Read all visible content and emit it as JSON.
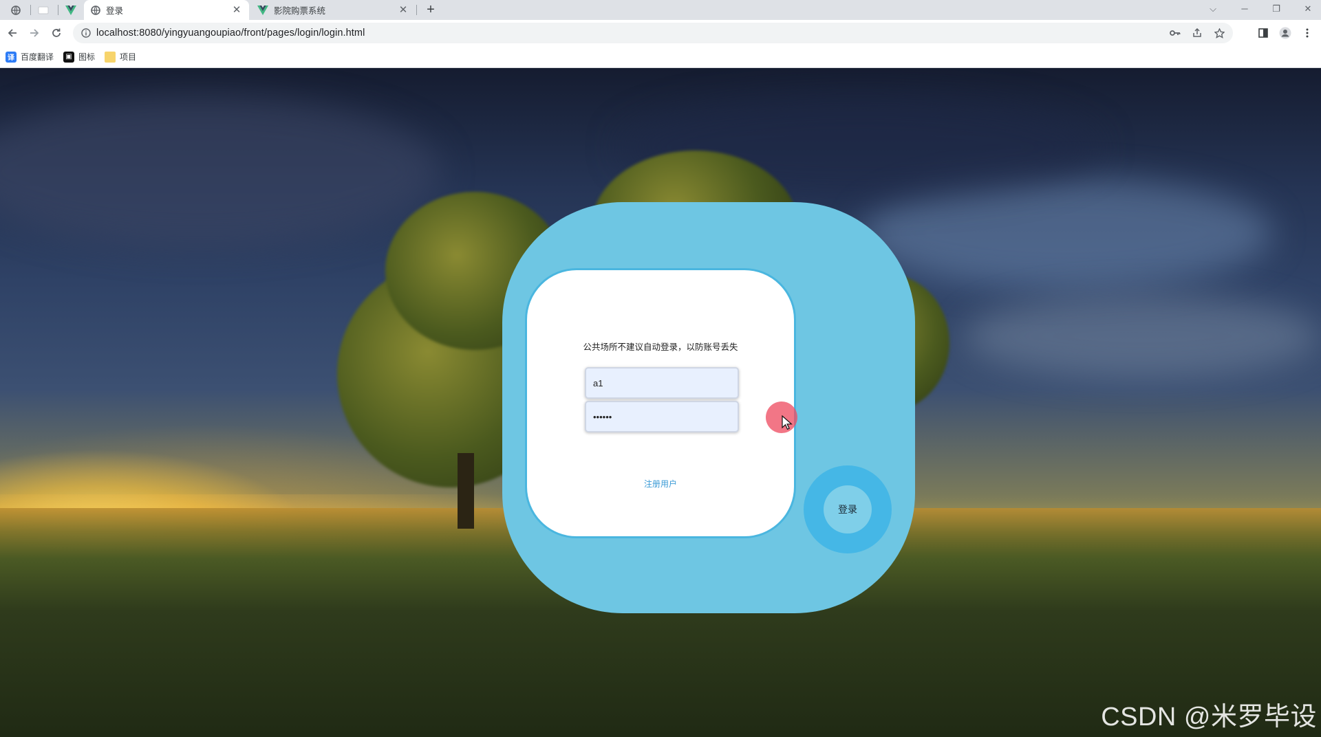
{
  "browser": {
    "tabs": [
      {
        "title": "登录",
        "active": true
      },
      {
        "title": "影院购票系统",
        "active": false
      }
    ],
    "address": "localhost:8080/yingyuangoupiao/front/pages/login/login.html",
    "bookmarks": [
      {
        "label": "百度翻译",
        "icon": "baidu-translate-icon"
      },
      {
        "label": "图标",
        "icon": "image-icon"
      },
      {
        "label": "项目",
        "icon": "folder-icon"
      }
    ]
  },
  "login": {
    "notice": "公共场所不建议自动登录，以防账号丢失",
    "username_value": "a1",
    "password_value": "••••••",
    "register_label": "注册用户",
    "login_button_label": "登录"
  },
  "watermark": "CSDN @米罗毕设",
  "colors": {
    "outer_card": "#6ec6e3",
    "inner_border": "#4ab6df",
    "login_ring": "#45b7e6",
    "input_bg": "#e8f0fe",
    "register_link": "#3a9ad6"
  }
}
